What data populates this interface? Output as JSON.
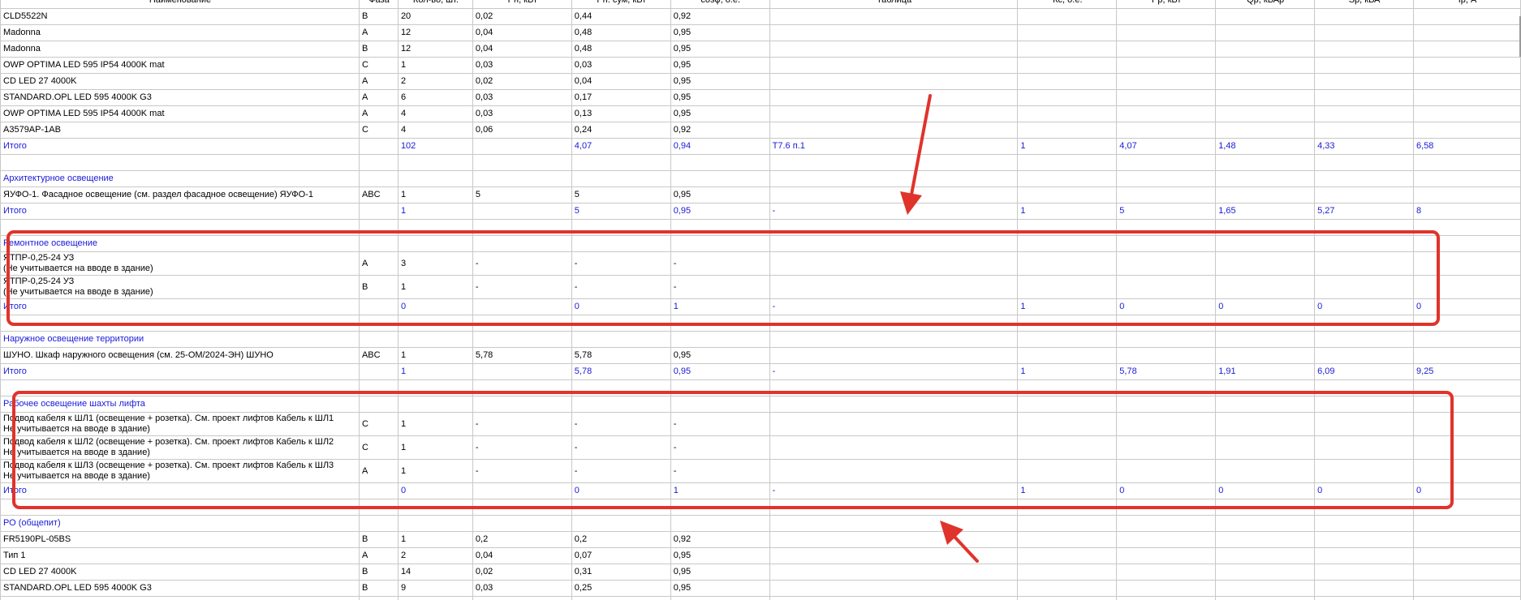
{
  "columns": [
    "Наименование",
    "Фаза",
    "Кол-во, шт.",
    "Рн, кВт",
    "Рн. сум, кВт",
    "cosφ, о.е.",
    "Таблица",
    "Кс, о.е.",
    "Рр, кВт",
    "Qр, кВАр",
    "Sр, кВА",
    "Iр, А"
  ],
  "rows": [
    {
      "type": "item",
      "cells": [
        "CLD5522N",
        "B",
        "20",
        "0,02",
        "0,44",
        "0,92",
        "",
        "",
        "",
        "",
        "",
        ""
      ]
    },
    {
      "type": "item",
      "cells": [
        "Madonna",
        "A",
        "12",
        "0,04",
        "0,48",
        "0,95",
        "",
        "",
        "",
        "",
        "",
        ""
      ]
    },
    {
      "type": "item",
      "cells": [
        "Madonna",
        "B",
        "12",
        "0,04",
        "0,48",
        "0,95",
        "",
        "",
        "",
        "",
        "",
        ""
      ]
    },
    {
      "type": "item",
      "cells": [
        "OWP OPTIMA LED 595 IP54 4000K mat",
        "C",
        "1",
        "0,03",
        "0,03",
        "0,95",
        "",
        "",
        "",
        "",
        "",
        ""
      ]
    },
    {
      "type": "item",
      "cells": [
        "CD LED 27 4000K",
        "A",
        "2",
        "0,02",
        "0,04",
        "0,95",
        "",
        "",
        "",
        "",
        "",
        ""
      ]
    },
    {
      "type": "item",
      "cells": [
        "STANDARD.OPL LED 595 4000K G3",
        "A",
        "6",
        "0,03",
        "0,17",
        "0,95",
        "",
        "",
        "",
        "",
        "",
        ""
      ]
    },
    {
      "type": "item",
      "cells": [
        "OWP OPTIMA LED 595 IP54 4000K mat",
        "A",
        "4",
        "0,03",
        "0,13",
        "0,95",
        "",
        "",
        "",
        "",
        "",
        ""
      ]
    },
    {
      "type": "item",
      "cells": [
        "A3579AP-1AB",
        "C",
        "4",
        "0,06",
        "0,24",
        "0,92",
        "",
        "",
        "",
        "",
        "",
        ""
      ]
    },
    {
      "type": "total",
      "cells": [
        "Итого",
        "",
        "102",
        "",
        "4,07",
        "0,94",
        "Т7.6 п.1",
        "1",
        "4,07",
        "1,48",
        "4,33",
        "6,58"
      ]
    },
    {
      "type": "blank",
      "cells": [
        "",
        "",
        "",
        "",
        "",
        "",
        "",
        "",
        "",
        "",
        "",
        ""
      ]
    },
    {
      "type": "section",
      "cells": [
        "Архитектурное освещение",
        "",
        "",
        "",
        "",
        "",
        "",
        "",
        "",
        "",
        "",
        ""
      ]
    },
    {
      "type": "item",
      "cells": [
        "ЯУФО-1. Фасадное освещение (см. раздел фасадное освещение) ЯУФО-1",
        "ABC",
        "1",
        "5",
        "5",
        "0,95",
        "",
        "",
        "",
        "",
        "",
        ""
      ]
    },
    {
      "type": "total",
      "cells": [
        "Итого",
        "",
        "1",
        "",
        "5",
        "0,95",
        "-",
        "1",
        "5",
        "1,65",
        "5,27",
        "8"
      ]
    },
    {
      "type": "blank",
      "cells": [
        "",
        "",
        "",
        "",
        "",
        "",
        "",
        "",
        "",
        "",
        "",
        ""
      ]
    },
    {
      "type": "section",
      "cells": [
        "Ремонтное освещение",
        "",
        "",
        "",
        "",
        "",
        "",
        "",
        "",
        "",
        "",
        ""
      ]
    },
    {
      "type": "item2",
      "cells": [
        "ЯТПР-0,25-24 УЗ",
        "A",
        "3",
        "-",
        "-",
        "-",
        "",
        "",
        "",
        "",
        "",
        ""
      ],
      "note": "(Не учитывается на вводе в здание)"
    },
    {
      "type": "item2",
      "cells": [
        "ЯТПР-0,25-24 УЗ",
        "B",
        "1",
        "-",
        "-",
        "-",
        "",
        "",
        "",
        "",
        "",
        ""
      ],
      "note": "(Не учитывается на вводе в здание)"
    },
    {
      "type": "total",
      "cells": [
        "Итого",
        "",
        "0",
        "",
        "0",
        "1",
        "-",
        "1",
        "0",
        "0",
        "0",
        "0"
      ]
    },
    {
      "type": "blank",
      "cells": [
        "",
        "",
        "",
        "",
        "",
        "",
        "",
        "",
        "",
        "",
        "",
        ""
      ]
    },
    {
      "type": "section",
      "cells": [
        "Наружное освещение территории",
        "",
        "",
        "",
        "",
        "",
        "",
        "",
        "",
        "",
        "",
        ""
      ]
    },
    {
      "type": "item",
      "cells": [
        "ШУНО. Шкаф наружного освещения (см. 25-ОМ/2024-ЭН) ШУНО",
        "ABC",
        "1",
        "5,78",
        "5,78",
        "0,95",
        "",
        "",
        "",
        "",
        "",
        ""
      ]
    },
    {
      "type": "total",
      "cells": [
        "Итого",
        "",
        "1",
        "",
        "5,78",
        "0,95",
        "-",
        "1",
        "5,78",
        "1,91",
        "6,09",
        "9,25"
      ]
    },
    {
      "type": "blank",
      "cells": [
        "",
        "",
        "",
        "",
        "",
        "",
        "",
        "",
        "",
        "",
        "",
        ""
      ]
    },
    {
      "type": "section",
      "cells": [
        "Рабочее освещение шахты лифта",
        "",
        "",
        "",
        "",
        "",
        "",
        "",
        "",
        "",
        "",
        ""
      ]
    },
    {
      "type": "item2",
      "cells": [
        "Подвод кабеля к ШЛ1 (освещение + розетка). См. проект лифтов Кабель к ШЛ1",
        "C",
        "1",
        "-",
        "-",
        "-",
        "",
        "",
        "",
        "",
        "",
        ""
      ],
      "note": "Не учитывается на вводе в здание)"
    },
    {
      "type": "item2",
      "cells": [
        "Подвод кабеля к ШЛ2 (освещение + розетка). См. проект лифтов Кабель к ШЛ2",
        "C",
        "1",
        "-",
        "-",
        "-",
        "",
        "",
        "",
        "",
        "",
        ""
      ],
      "note": "Не учитывается на вводе в здание)"
    },
    {
      "type": "item2",
      "cells": [
        "Подвод кабеля к ШЛ3 (освещение + розетка). См. проект лифтов Кабель к ШЛ3",
        "A",
        "1",
        "-",
        "-",
        "-",
        "",
        "",
        "",
        "",
        "",
        ""
      ],
      "note": "Не учитывается на вводе в здание)"
    },
    {
      "type": "total",
      "cells": [
        "Итого",
        "",
        "0",
        "",
        "0",
        "1",
        "-",
        "1",
        "0",
        "0",
        "0",
        "0"
      ]
    },
    {
      "type": "blank",
      "cells": [
        "",
        "",
        "",
        "",
        "",
        "",
        "",
        "",
        "",
        "",
        "",
        ""
      ]
    },
    {
      "type": "section",
      "cells": [
        "РО (общепит)",
        "",
        "",
        "",
        "",
        "",
        "",
        "",
        "",
        "",
        "",
        ""
      ]
    },
    {
      "type": "item",
      "cells": [
        "FR5190PL-05BS",
        "B",
        "1",
        "0,2",
        "0,2",
        "0,92",
        "",
        "",
        "",
        "",
        "",
        ""
      ]
    },
    {
      "type": "item",
      "cells": [
        "Тип 1",
        "A",
        "2",
        "0,04",
        "0,07",
        "0,95",
        "",
        "",
        "",
        "",
        "",
        ""
      ]
    },
    {
      "type": "item",
      "cells": [
        "CD LED 27 4000K",
        "B",
        "14",
        "0,02",
        "0,31",
        "0,95",
        "",
        "",
        "",
        "",
        "",
        ""
      ]
    },
    {
      "type": "item",
      "cells": [
        "STANDARD.OPL LED 595 4000K G3",
        "B",
        "9",
        "0,03",
        "0,25",
        "0,95",
        "",
        "",
        "",
        "",
        "",
        ""
      ]
    },
    {
      "type": "blank",
      "cells": [
        "",
        "",
        "",
        "",
        "",
        "",
        "",
        "",
        "",
        "",
        "",
        ""
      ]
    }
  ],
  "annotation_color": "#e0332b",
  "grid_color": "#c8c8c8",
  "text_blue": "#1a1adb"
}
